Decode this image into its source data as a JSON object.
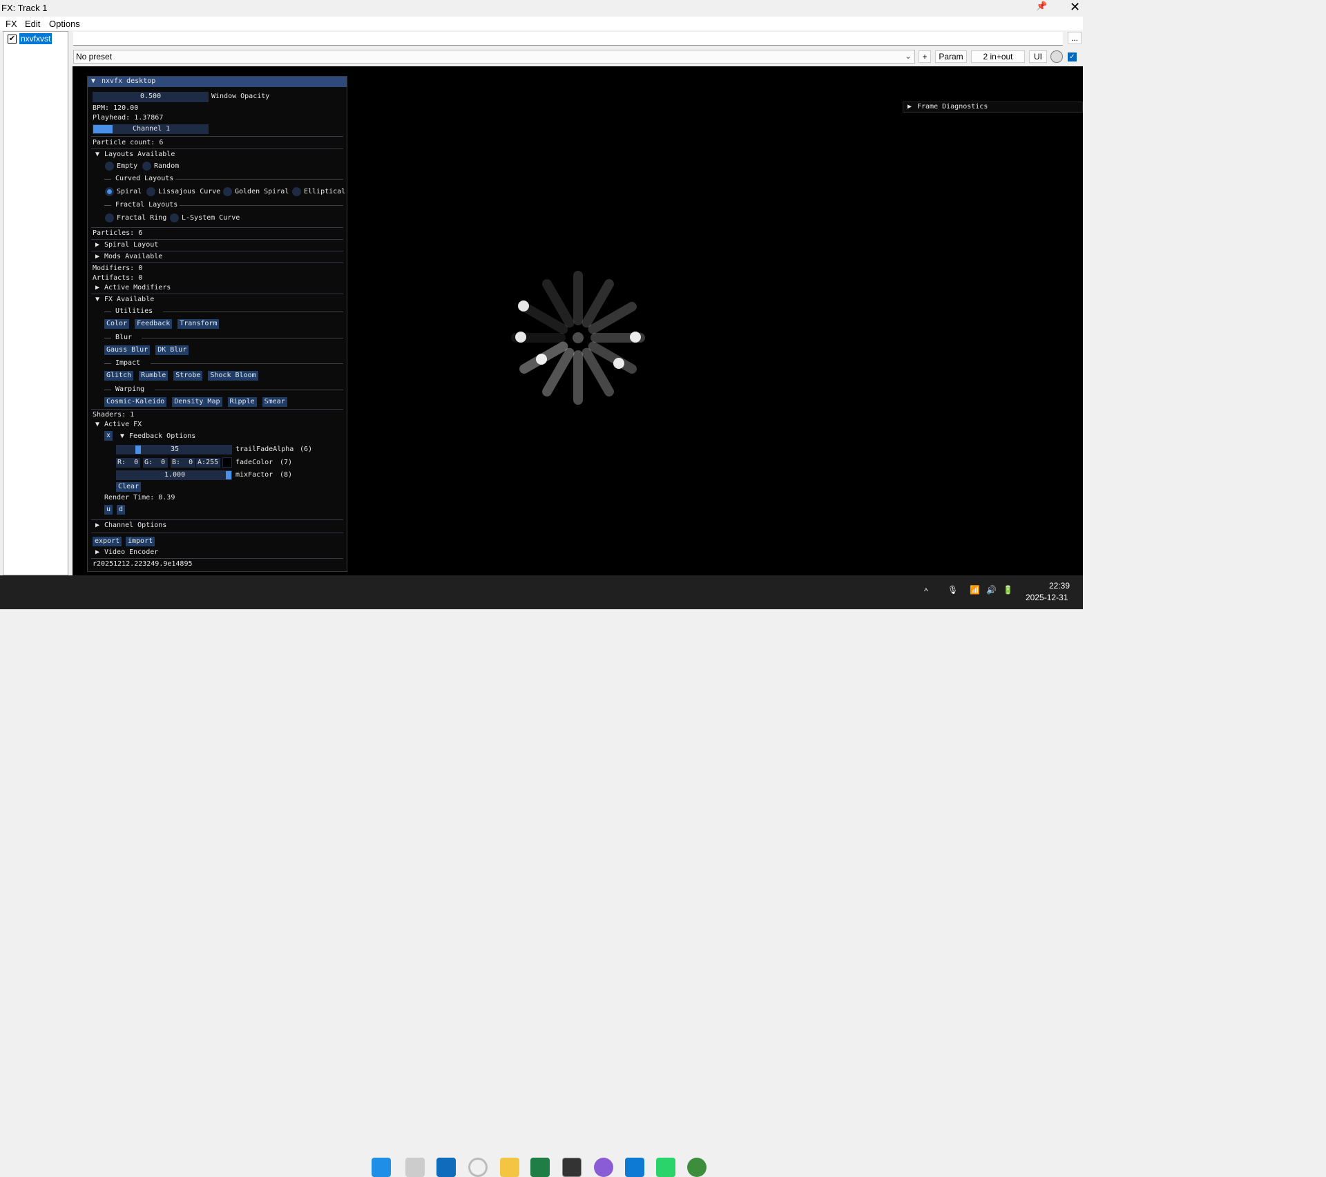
{
  "window": {
    "title": "FX: Track 1"
  },
  "menu": [
    "FX",
    "Edit",
    "Options"
  ],
  "fx_list": [
    {
      "name": "nxvfxvst",
      "enabled": true
    }
  ],
  "toolbar": {
    "more": "...",
    "preset": "No preset",
    "add": "+",
    "param": "Param",
    "io": "2 in+out",
    "ui": "UI"
  },
  "panel": {
    "title": "nxvfx desktop",
    "opacity_value": "0.500",
    "opacity_label": "Window Opacity",
    "bpm": "BPM: 120.00",
    "playhead": "Playhead: 1.37867",
    "channel": "Channel 1",
    "particle_count": "Particle count: 6",
    "layouts_header": "Layouts Available",
    "basic_layouts": [
      "Empty",
      "Random"
    ],
    "curved_header": "Curved Layouts",
    "curved_layouts": [
      "Spiral",
      "Lissajous Curve",
      "Golden Spiral",
      "Elliptical"
    ],
    "selected_layout": "Spiral",
    "fractal_header": "Fractal Layouts",
    "fractal_layouts": [
      "Fractal Ring",
      "L-System Curve"
    ],
    "particles": "Particles: 6",
    "spiral_layout": "Spiral Layout",
    "mods_available": "Mods Available",
    "modifiers": "Modifiers: 0",
    "artifacts": "Artifacts: 0",
    "active_modifiers": "Active Modifiers",
    "fx_available": "FX Available",
    "fx_groups": [
      {
        "name": "Utilities",
        "items": [
          "Color",
          "Feedback",
          "Transform"
        ]
      },
      {
        "name": "Blur",
        "items": [
          "Gauss Blur",
          "DK Blur"
        ]
      },
      {
        "name": "Impact",
        "items": [
          "Glitch",
          "Rumble",
          "Strobe",
          "Shock Bloom"
        ]
      },
      {
        "name": "Warping",
        "items": [
          "Cosmic-Kaleido",
          "Density Map",
          "Ripple",
          "Smear"
        ]
      }
    ],
    "shaders": "Shaders: 1",
    "active_fx": "Active FX",
    "remove": "x",
    "feedback_options": "Feedback Options",
    "trail_value": "35",
    "trail_label": "trailFadeAlpha",
    "trail_idx": "(6)",
    "color_r": "R:  0",
    "color_g": "G:  0",
    "color_b": "B:  0",
    "color_a": "A:255",
    "fade_label": "fadeColor",
    "fade_idx": "(7)",
    "mix_value": "1.000",
    "mix_label": "mixFactor",
    "mix_idx": "(8)",
    "clear": "Clear",
    "render_time": "Render Time: 0.39",
    "up": "u",
    "down": "d",
    "channel_options": "Channel Options",
    "export": "export",
    "import": "import",
    "video_encoder": "Video Encoder",
    "version": "r20251212.223249.9e14895"
  },
  "frame_diagnostics": "Frame Diagnostics",
  "taskbar": {
    "time": "22:39",
    "date": "2025-12-31"
  }
}
